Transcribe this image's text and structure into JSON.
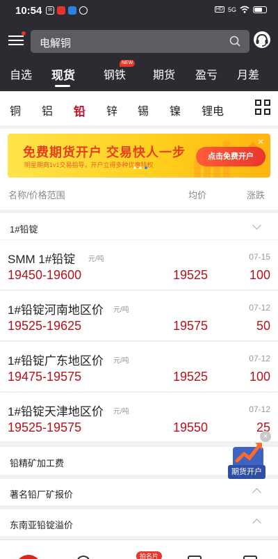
{
  "status_bar": {
    "time": "10:54",
    "signal": "5G",
    "hd": "HD"
  },
  "search": {
    "value": "电解铜"
  },
  "nav": {
    "tabs": [
      {
        "label": "自选"
      },
      {
        "label": "现货"
      },
      {
        "label": "钢铁"
      },
      {
        "label": "期货"
      },
      {
        "label": "盈亏"
      },
      {
        "label": "月差"
      }
    ],
    "active_tab": "现货",
    "new_badge": "NEW"
  },
  "subnav": {
    "items": [
      {
        "label": "铜"
      },
      {
        "label": "铝"
      },
      {
        "label": "铅"
      },
      {
        "label": "锌"
      },
      {
        "label": "锡"
      },
      {
        "label": "镍"
      },
      {
        "label": "锂电"
      }
    ],
    "active_item": "铅"
  },
  "banner": {
    "title": "免费期货开户  交易快人一步",
    "subtitle": "明星期商1v1交易指导，开户立得多种优惠特权",
    "cta": "点击免费开户"
  },
  "columns": {
    "name": "名称/价格范围",
    "avg": "均价",
    "change": "涨跌"
  },
  "sections": {
    "lead_ingot": "1#铅锭",
    "concentrate_fee": "铅精矿加工费",
    "smelter_quotes": "著名铅厂矿报价",
    "sea_premium": "东南亚铅锭溢价"
  },
  "rows": [
    {
      "name": "SMM 1#铅锭",
      "unit": "元/吨",
      "date": "07-15",
      "range": "19450-19600",
      "avg": "19525",
      "change": "100"
    },
    {
      "name": "1#铅锭河南地区价",
      "unit": "元/吨",
      "date": "07-12",
      "range": "19525-19625",
      "avg": "19575",
      "change": "50"
    },
    {
      "name": "1#铅锭广东地区价",
      "unit": "元/吨",
      "date": "07-12",
      "range": "19475-19575",
      "avg": "19525",
      "change": "100"
    },
    {
      "name": "1#铅锭天津地区价",
      "unit": "元/吨",
      "date": "07-12",
      "range": "19525-19575",
      "avg": "19550",
      "change": "25"
    }
  ],
  "floating": {
    "label": "期货开户"
  },
  "bottom": {
    "badge": "拍名片"
  },
  "colors": {
    "header_bg": "#2b2b31",
    "accent_red": "#b5121b",
    "banner_yellow": "#ffce1c"
  }
}
